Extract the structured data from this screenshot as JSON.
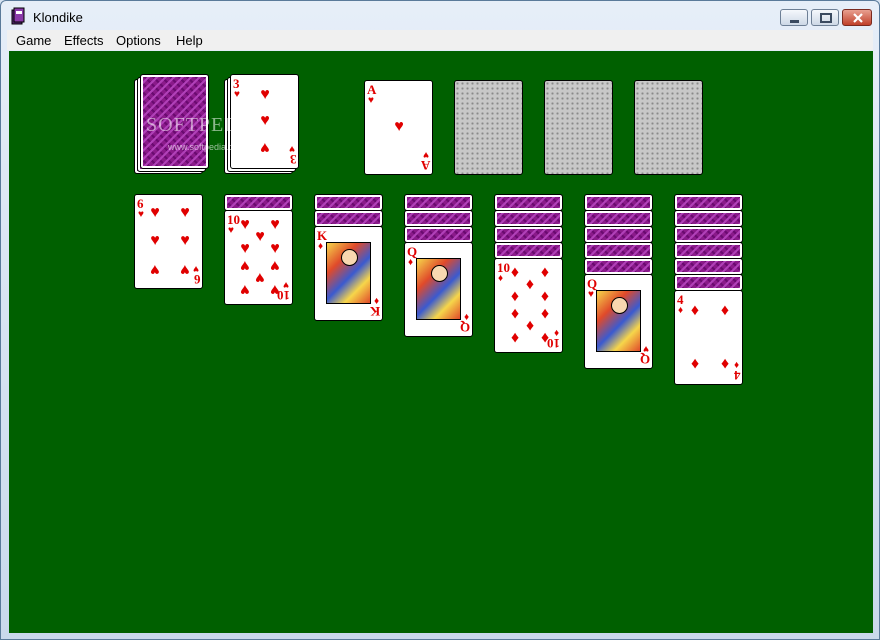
{
  "window": {
    "title": "Klondike"
  },
  "menu": [
    "Game",
    "Effects",
    "Options",
    "Help"
  ],
  "watermark": {
    "text": "SOFTPEDIA",
    "url": "www.softpedia.com"
  },
  "suit_symbol": {
    "hearts": "♥",
    "diamonds": "♦"
  },
  "waste": {
    "rank": "3",
    "suit": "hearts"
  },
  "foundations": [
    {
      "rank": "A",
      "suit": "hearts"
    },
    {
      "empty": true
    },
    {
      "empty": true
    },
    {
      "empty": true
    }
  ],
  "tableau": [
    {
      "hidden": 0,
      "top": {
        "rank": "6",
        "suit": "hearts"
      }
    },
    {
      "hidden": 1,
      "top": {
        "rank": "10",
        "suit": "hearts"
      }
    },
    {
      "hidden": 2,
      "top": {
        "rank": "K",
        "suit": "diamonds"
      }
    },
    {
      "hidden": 3,
      "top": {
        "rank": "Q",
        "suit": "diamonds"
      }
    },
    {
      "hidden": 4,
      "top": {
        "rank": "10",
        "suit": "diamonds"
      }
    },
    {
      "hidden": 5,
      "top": {
        "rank": "Q",
        "suit": "hearts"
      }
    },
    {
      "hidden": 6,
      "top": {
        "rank": "4",
        "suit": "diamonds"
      }
    }
  ],
  "colors": {
    "felt": "#006000",
    "red_suit": "#e00000",
    "card_back": "#8a1a8a"
  }
}
